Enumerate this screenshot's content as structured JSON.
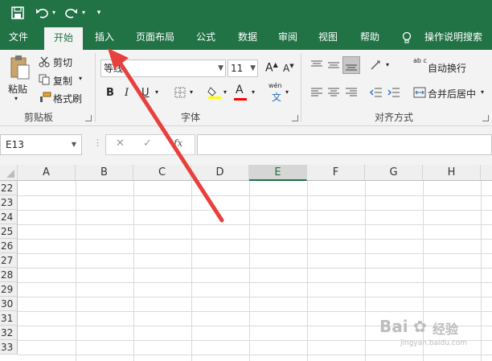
{
  "qat": {
    "save_icon": "save-icon",
    "undo_icon": "undo-icon",
    "redo_icon": "redo-icon",
    "customize_icon": "customize-qat-icon"
  },
  "tabs": [
    {
      "label": "文件"
    },
    {
      "label": "开始"
    },
    {
      "label": "插入"
    },
    {
      "label": "页面布局"
    },
    {
      "label": "公式"
    },
    {
      "label": "数据"
    },
    {
      "label": "审阅"
    },
    {
      "label": "视图"
    },
    {
      "label": "帮助"
    }
  ],
  "tell_me": {
    "label": "操作说明搜索",
    "icon": "lightbulb-icon"
  },
  "clipboard": {
    "paste": "粘贴",
    "cut": "剪切",
    "copy": "复制",
    "format_painter": "格式刷",
    "group_label": "剪贴板"
  },
  "font": {
    "font_name": "等线",
    "font_size": "11",
    "bold": "B",
    "italic": "I",
    "underline": "U",
    "font_color_glyph": "A",
    "grow": "A",
    "shrink": "A",
    "phonetic_top": "wén",
    "phonetic_bottom": "文",
    "group_label": "字体",
    "highlight_color": "#ffff00",
    "font_color": "#ff0000"
  },
  "alignment": {
    "wrap_text": "自动换行",
    "merge_center": "合并后居中",
    "group_label": "对齐方式",
    "wrap_glyph": "ab c"
  },
  "formula_bar": {
    "name_box": "E13",
    "cancel_glyph": "✕",
    "enter_glyph": "✓",
    "fx_glyph": "fx",
    "formula": ""
  },
  "grid": {
    "columns": [
      "A",
      "B",
      "C",
      "D",
      "E",
      "F",
      "G",
      "H"
    ],
    "selected_column": "E",
    "rows": [
      "22",
      "23",
      "24",
      "25",
      "26",
      "27",
      "28",
      "29",
      "30",
      "31",
      "32",
      "33"
    ]
  },
  "watermark": {
    "brand": "Bai",
    "brand2": "经验",
    "url": "jingyan.baidu.com"
  },
  "colors": {
    "excel_green": "#217346",
    "arrow": "#e8403c"
  }
}
